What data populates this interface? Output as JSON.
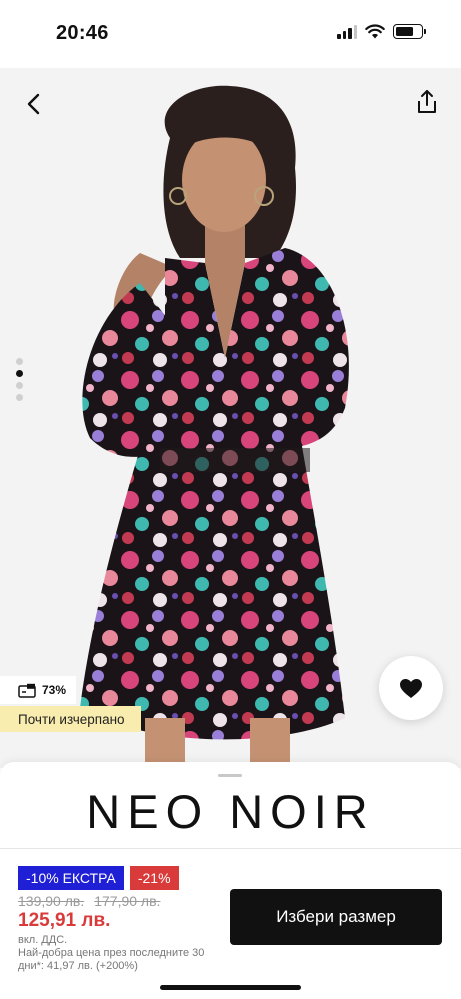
{
  "status_bar": {
    "time": "20:46"
  },
  "product": {
    "brand": "NEO NOIR",
    "image_count": 4,
    "active_image": 1,
    "stock": {
      "icon": "bag-size-icon",
      "percent": "73%",
      "low_stock_label": "Почти изчерпано"
    },
    "badges": [
      "-10% ЕКСТРА",
      "-21%"
    ],
    "old_prices": [
      "139,90 лв.",
      "177,90 лв."
    ],
    "price": "125,91 лв.",
    "vat_note": "вкл. ДДС.",
    "lowest_price_note": "Най-добра цена през последните 30 дни*: 41,97 лв. (+200%)"
  },
  "actions": {
    "choose_size_label": "Избери размер"
  },
  "colors": {
    "accent_red": "#d93a3a",
    "badge_blue": "#1f1fd6",
    "low_stock_bg": "#f8ecae",
    "cta_bg": "#111111"
  }
}
